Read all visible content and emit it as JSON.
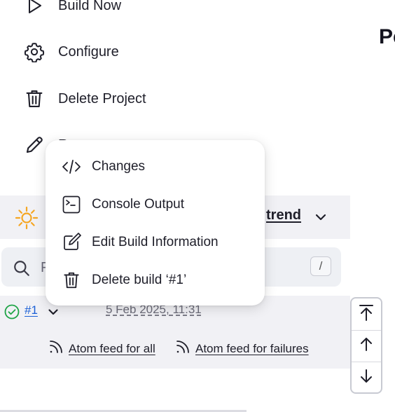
{
  "sidebar": {
    "items": [
      {
        "label": "Build Now",
        "icon": "play-icon"
      },
      {
        "label": "Configure",
        "icon": "gear-icon"
      },
      {
        "label": "Delete Project",
        "icon": "trash-icon"
      },
      {
        "label": "R",
        "icon": "pencil-icon"
      }
    ]
  },
  "header": {
    "title_fragment": "Pe"
  },
  "build_history": {
    "trend_label": "trend",
    "search": {
      "placeholder": "F",
      "shortcut_key": "/"
    },
    "builds": [
      {
        "number": "#1",
        "timestamp": "5 Feb 2025, 11:31",
        "status": "success"
      }
    ],
    "feeds": {
      "all_label": "Atom feed for all",
      "failures_label": "Atom feed for failures"
    }
  },
  "build_menu": {
    "items": [
      {
        "label": "Changes",
        "icon": "code-icon"
      },
      {
        "label": "Console Output",
        "icon": "terminal-icon"
      },
      {
        "label": "Edit Build Information",
        "icon": "edit-icon"
      },
      {
        "label": "Delete build ‘#1’",
        "icon": "trash-icon"
      }
    ]
  },
  "scroll_controls": {
    "buttons": [
      "scroll-to-top-icon",
      "arrow-up-icon",
      "arrow-down-icon"
    ]
  },
  "colors": {
    "link": "#1a5fd6",
    "success": "#1ea446",
    "sun": "#f5a623",
    "panel_bg": "#f1f1f5"
  }
}
